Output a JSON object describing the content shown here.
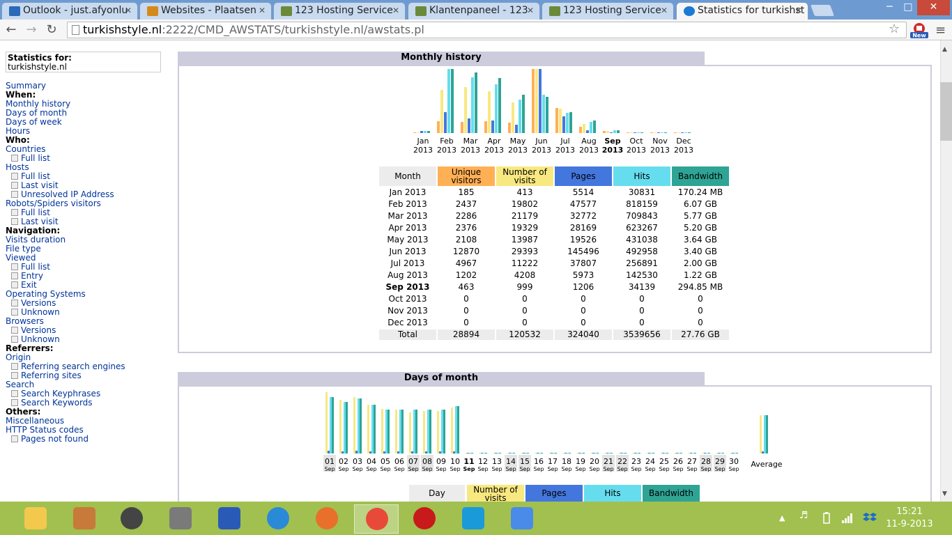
{
  "browser": {
    "tabs": [
      {
        "label": "Outlook - just.afyonlu",
        "color": "#2a6ab8"
      },
      {
        "label": "Websites - Plaatsen",
        "color": "#d48a1a"
      },
      {
        "label": "123 Hosting Service",
        "color": "#6a8a3a"
      },
      {
        "label": "Klantenpaneel - 123",
        "color": "#6a8a3a"
      },
      {
        "label": "123 Hosting Service",
        "color": "#6a8a3a"
      },
      {
        "label": "Statistics for turkishst",
        "color": "#1a7ad4"
      }
    ],
    "url_host": "turkishstyle.nl",
    "url_rest": ":2222/CMD_AWSTATS/turkishstyle.nl/awstats.pl",
    "new_badge": "New"
  },
  "sidebar": {
    "stat_for_label": "Statistics for:",
    "site": "turkishstyle.nl",
    "items": [
      {
        "t": "Summary",
        "k": "link"
      },
      {
        "t": "When:",
        "k": "head"
      },
      {
        "t": "Monthly history",
        "k": "link"
      },
      {
        "t": "Days of month",
        "k": "link"
      },
      {
        "t": "Days of week",
        "k": "link"
      },
      {
        "t": "Hours",
        "k": "link"
      },
      {
        "t": "Who:",
        "k": "head"
      },
      {
        "t": "Countries",
        "k": "link"
      },
      {
        "t": "Full list",
        "k": "sub"
      },
      {
        "t": "Hosts",
        "k": "link"
      },
      {
        "t": "Full list",
        "k": "sub"
      },
      {
        "t": "Last visit",
        "k": "sub"
      },
      {
        "t": "Unresolved IP Address",
        "k": "sub"
      },
      {
        "t": "Robots/Spiders visitors",
        "k": "link"
      },
      {
        "t": "Full list",
        "k": "sub"
      },
      {
        "t": "Last visit",
        "k": "sub"
      },
      {
        "t": "Navigation:",
        "k": "head"
      },
      {
        "t": "Visits duration",
        "k": "link"
      },
      {
        "t": "File type",
        "k": "link"
      },
      {
        "t": "Viewed",
        "k": "link"
      },
      {
        "t": "Full list",
        "k": "sub"
      },
      {
        "t": "Entry",
        "k": "sub"
      },
      {
        "t": "Exit",
        "k": "sub"
      },
      {
        "t": "Operating Systems",
        "k": "link"
      },
      {
        "t": "Versions",
        "k": "sub"
      },
      {
        "t": "Unknown",
        "k": "sub"
      },
      {
        "t": "Browsers",
        "k": "link"
      },
      {
        "t": "Versions",
        "k": "sub"
      },
      {
        "t": "Unknown",
        "k": "sub"
      },
      {
        "t": "Referrers:",
        "k": "head"
      },
      {
        "t": "Origin",
        "k": "link"
      },
      {
        "t": "Referring search engines",
        "k": "sub"
      },
      {
        "t": "Referring sites",
        "k": "sub"
      },
      {
        "t": "Search",
        "k": "link"
      },
      {
        "t": "Search Keyphrases",
        "k": "sub"
      },
      {
        "t": "Search Keywords",
        "k": "sub"
      },
      {
        "t": "Others:",
        "k": "head"
      },
      {
        "t": "Miscellaneous",
        "k": "link"
      },
      {
        "t": "HTTP Status codes",
        "k": "link"
      },
      {
        "t": "Pages not found",
        "k": "sub"
      }
    ]
  },
  "monthly": {
    "title": "Monthly history",
    "headers": {
      "month": "Month",
      "unique": "Unique visitors",
      "visits": "Number of visits",
      "pages": "Pages",
      "hits": "Hits",
      "bandwidth": "Bandwidth"
    },
    "months": [
      {
        "m": "Jan",
        "y": "2013",
        "label": "Jan 2013",
        "u": 185,
        "v": 413,
        "p": 5514,
        "h": 30831,
        "b": "170.24 MB",
        "bw": 0.17
      },
      {
        "m": "Feb",
        "y": "2013",
        "label": "Feb 2013",
        "u": 2437,
        "v": 19802,
        "p": 47577,
        "h": 818159,
        "b": "6.07 GB",
        "bw": 6.07
      },
      {
        "m": "Mar",
        "y": "2013",
        "label": "Mar 2013",
        "u": 2286,
        "v": 21179,
        "p": 32772,
        "h": 709843,
        "b": "5.77 GB",
        "bw": 5.77
      },
      {
        "m": "Apr",
        "y": "2013",
        "label": "Apr 2013",
        "u": 2376,
        "v": 19329,
        "p": 28169,
        "h": 623267,
        "b": "5.20 GB",
        "bw": 5.2
      },
      {
        "m": "May",
        "y": "2013",
        "label": "May 2013",
        "u": 2108,
        "v": 13987,
        "p": 19526,
        "h": 431038,
        "b": "3.64 GB",
        "bw": 3.64
      },
      {
        "m": "Jun",
        "y": "2013",
        "label": "Jun 2013",
        "u": 12870,
        "v": 29393,
        "p": 145496,
        "h": 492958,
        "b": "3.40 GB",
        "bw": 3.4
      },
      {
        "m": "Jul",
        "y": "2013",
        "label": "Jul 2013",
        "u": 4967,
        "v": 11222,
        "p": 37807,
        "h": 256891,
        "b": "2.00 GB",
        "bw": 2.0
      },
      {
        "m": "Aug",
        "y": "2013",
        "label": "Aug 2013",
        "u": 1202,
        "v": 4208,
        "p": 5973,
        "h": 142530,
        "b": "1.22 GB",
        "bw": 1.22
      },
      {
        "m": "Sep",
        "y": "2013",
        "label": "Sep 2013",
        "u": 463,
        "v": 999,
        "p": 1206,
        "h": 34139,
        "b": "294.85 MB",
        "bw": 0.29,
        "current": true
      },
      {
        "m": "Oct",
        "y": "2013",
        "label": "Oct 2013",
        "u": 0,
        "v": 0,
        "p": 0,
        "h": 0,
        "b": "0",
        "bw": 0
      },
      {
        "m": "Nov",
        "y": "2013",
        "label": "Nov 2013",
        "u": 0,
        "v": 0,
        "p": 0,
        "h": 0,
        "b": "0",
        "bw": 0
      },
      {
        "m": "Dec",
        "y": "2013",
        "label": "Dec 2013",
        "u": 0,
        "v": 0,
        "p": 0,
        "h": 0,
        "b": "0",
        "bw": 0
      }
    ],
    "total": {
      "label": "Total",
      "u": 28894,
      "v": 120532,
      "p": 324040,
      "h": 3539656,
      "b": "27.76 GB"
    }
  },
  "daily": {
    "title": "Days of month",
    "month_abbr": "Sep",
    "average_label": "Average",
    "days": [
      {
        "d": "01",
        "we": true,
        "v": 96,
        "p": 92,
        "h": 88
      },
      {
        "d": "02",
        "we": false,
        "v": 84,
        "p": 82,
        "h": 80
      },
      {
        "d": "03",
        "we": false,
        "v": 88,
        "p": 92,
        "h": 86
      },
      {
        "d": "04",
        "we": false,
        "v": 76,
        "p": 78,
        "h": 76
      },
      {
        "d": "05",
        "we": false,
        "v": 70,
        "p": 70,
        "h": 68
      },
      {
        "d": "06",
        "we": false,
        "v": 68,
        "p": 68,
        "h": 68
      },
      {
        "d": "07",
        "we": true,
        "v": 64,
        "p": 68,
        "h": 68
      },
      {
        "d": "08",
        "we": true,
        "v": 66,
        "p": 68,
        "h": 68
      },
      {
        "d": "09",
        "we": false,
        "v": 66,
        "p": 68,
        "h": 68
      },
      {
        "d": "10",
        "we": false,
        "v": 72,
        "p": 76,
        "h": 74
      },
      {
        "d": "11",
        "we": false,
        "current": true,
        "v": 0,
        "p": 0,
        "h": 0
      },
      {
        "d": "12",
        "we": false,
        "v": 0,
        "p": 0,
        "h": 0
      },
      {
        "d": "13",
        "we": false,
        "v": 0,
        "p": 0,
        "h": 0
      },
      {
        "d": "14",
        "we": true,
        "v": 0,
        "p": 0,
        "h": 0
      },
      {
        "d": "15",
        "we": true,
        "v": 0,
        "p": 0,
        "h": 0
      },
      {
        "d": "16",
        "we": false,
        "v": 0,
        "p": 0,
        "h": 0
      },
      {
        "d": "17",
        "we": false,
        "v": 0,
        "p": 0,
        "h": 0
      },
      {
        "d": "18",
        "we": false,
        "v": 0,
        "p": 0,
        "h": 0
      },
      {
        "d": "19",
        "we": false,
        "v": 0,
        "p": 0,
        "h": 0
      },
      {
        "d": "20",
        "we": false,
        "v": 0,
        "p": 0,
        "h": 0
      },
      {
        "d": "21",
        "we": true,
        "v": 0,
        "p": 0,
        "h": 0
      },
      {
        "d": "22",
        "we": true,
        "v": 0,
        "p": 0,
        "h": 0
      },
      {
        "d": "23",
        "we": false,
        "v": 0,
        "p": 0,
        "h": 0
      },
      {
        "d": "24",
        "we": false,
        "v": 0,
        "p": 0,
        "h": 0
      },
      {
        "d": "25",
        "we": false,
        "v": 0,
        "p": 0,
        "h": 0
      },
      {
        "d": "26",
        "we": false,
        "v": 0,
        "p": 0,
        "h": 0
      },
      {
        "d": "27",
        "we": false,
        "v": 0,
        "p": 0,
        "h": 0
      },
      {
        "d": "28",
        "we": true,
        "v": 0,
        "p": 0,
        "h": 0
      },
      {
        "d": "29",
        "we": true,
        "v": 0,
        "p": 0,
        "h": 0
      },
      {
        "d": "30",
        "we": false,
        "v": 0,
        "p": 0,
        "h": 0
      }
    ],
    "average": {
      "v": 60,
      "p": 62,
      "h": 60
    },
    "headers": {
      "day": "Day",
      "visits": "Number of visits",
      "pages": "Pages",
      "hits": "Hits",
      "bandwidth": "Bandwidth"
    }
  },
  "colors": {
    "unique": "#ffb055",
    "visits": "#f8e880",
    "pages": "#4477dd",
    "hits": "#66ddee",
    "bandwidth": "#2ea495"
  },
  "taskbar": {
    "icons": [
      "explorer-icon",
      "app-icon",
      "speaker-app-icon",
      "doc-icon",
      "settings-app-icon",
      "ie-icon",
      "firefox-icon",
      "chrome-icon",
      "power-icon",
      "skype-icon",
      "star-app-icon"
    ],
    "time": "15:21",
    "date": "11-9-2013"
  }
}
